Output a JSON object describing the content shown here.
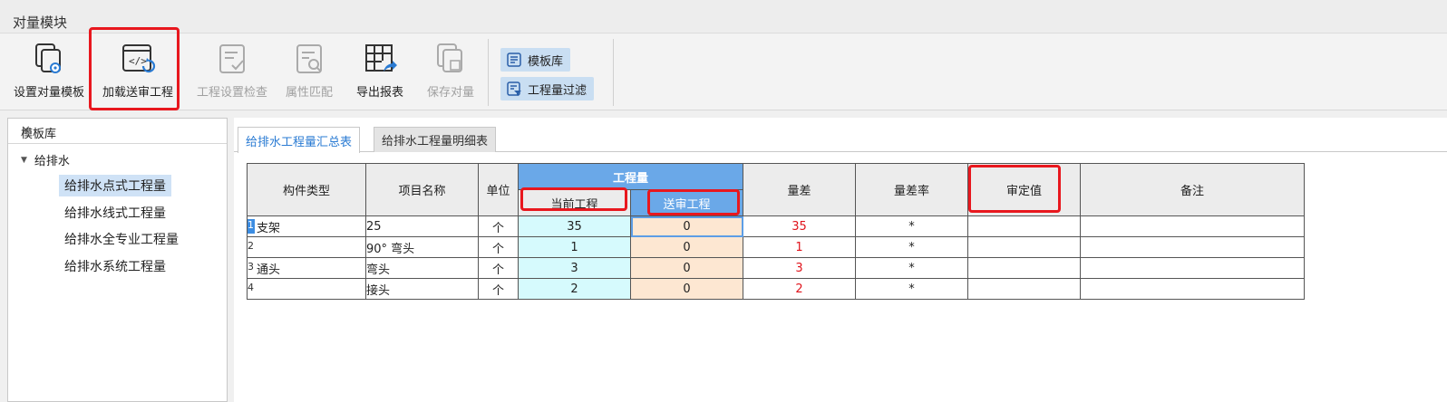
{
  "window": {
    "title": "对量模块"
  },
  "ribbon": {
    "buttons": [
      {
        "label": "设置对量模板",
        "icon": "template-settings-icon",
        "enabled": true
      },
      {
        "label": "加载送审工程",
        "icon": "load-project-icon",
        "enabled": true
      },
      {
        "label": "工程设置检查",
        "icon": "settings-check-icon",
        "enabled": false
      },
      {
        "label": "属性匹配",
        "icon": "attribute-match-icon",
        "enabled": false
      },
      {
        "label": "导出报表",
        "icon": "export-report-icon",
        "enabled": true
      },
      {
        "label": "保存对量",
        "icon": "save-compare-icon",
        "enabled": false
      }
    ],
    "toggle_template_lib": "模板库",
    "toggle_quantity_filter": "工程量过滤"
  },
  "left_panel": {
    "title": "模板库",
    "close_label": "✕",
    "root": "给排水",
    "items": [
      "给排水点式工程量",
      "给排水线式工程量",
      "给排水全专业工程量",
      "给排水系统工程量"
    ],
    "selected_index": 0
  },
  "tabs": [
    {
      "label": "给排水工程量汇总表",
      "active": true
    },
    {
      "label": "给排水工程量明细表",
      "active": false
    }
  ],
  "table": {
    "headers": {
      "component_type": "构件类型",
      "item_name": "项目名称",
      "unit": "单位",
      "quantity": "工程量",
      "current_project": "当前工程",
      "submitted_project": "送审工程",
      "difference": "量差",
      "difference_rate": "量差率",
      "approved_value": "审定值",
      "remarks": "备注"
    },
    "rows": [
      {
        "no": "1",
        "type": "支架",
        "name": "25",
        "unit": "个",
        "current": "35",
        "submitted": "0",
        "diff": "35",
        "rate": "*",
        "approved": "",
        "remark": ""
      },
      {
        "no": "2",
        "type": "",
        "name": "90° 弯头",
        "unit": "个",
        "current": "1",
        "submitted": "0",
        "diff": "1",
        "rate": "*",
        "approved": "",
        "remark": ""
      },
      {
        "no": "3",
        "type": "通头",
        "name": "弯头",
        "unit": "个",
        "current": "3",
        "submitted": "0",
        "diff": "3",
        "rate": "*",
        "approved": "",
        "remark": ""
      },
      {
        "no": "4",
        "type": "",
        "name": "接头",
        "unit": "个",
        "current": "2",
        "submitted": "0",
        "diff": "2",
        "rate": "*",
        "approved": "",
        "remark": ""
      }
    ]
  },
  "colors": {
    "highlight_box": "#e8171e",
    "header_blue": "#6aa8e8",
    "diff_red": "#e0141c"
  }
}
